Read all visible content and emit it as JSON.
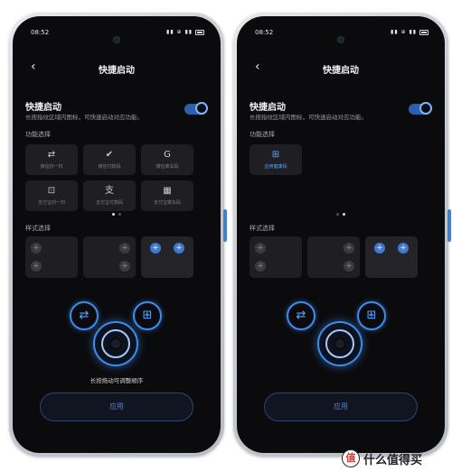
{
  "status": {
    "time": "08:52",
    "icons": "▮▮ ⊕ ▮▮"
  },
  "header": {
    "title": "快捷启动",
    "back_glyph": "‹"
  },
  "quick_start": {
    "title": "快捷启动",
    "description": "长按指纹区域内图标，可快速启动对应功能。",
    "toggle_on": true
  },
  "sections": {
    "function_select": "功能选择",
    "style_select": "样式选择"
  },
  "left_functions": [
    {
      "icon": "⇄",
      "label": "微信扫一扫",
      "active": true
    },
    {
      "icon": "✔",
      "label": "微信付款码",
      "active": false
    },
    {
      "icon": "G",
      "label": "微信乘车码",
      "active": false
    },
    {
      "icon": "⊡",
      "label": "支付宝扫一扫",
      "active": false
    },
    {
      "icon": "支",
      "label": "支付宝付款码",
      "active": false
    },
    {
      "icon": "▦",
      "label": "支付宝乘车码",
      "active": false
    }
  ],
  "right_functions": [
    {
      "icon": "⊞",
      "label": "应用健康码",
      "active": true
    }
  ],
  "dots": {
    "left_active_index": 0,
    "right_active_index": 1
  },
  "ring_icons": {
    "left": "⇄",
    "right": "⊞"
  },
  "hint": "长按拖动可调整顺序",
  "apply_button": "应用",
  "watermark": {
    "logo": "值",
    "text": "什么值得买"
  },
  "colors": {
    "accent": "#3c8cf0",
    "screen_bg": "#0b0b0d",
    "cell_bg": "#1f1f23"
  }
}
